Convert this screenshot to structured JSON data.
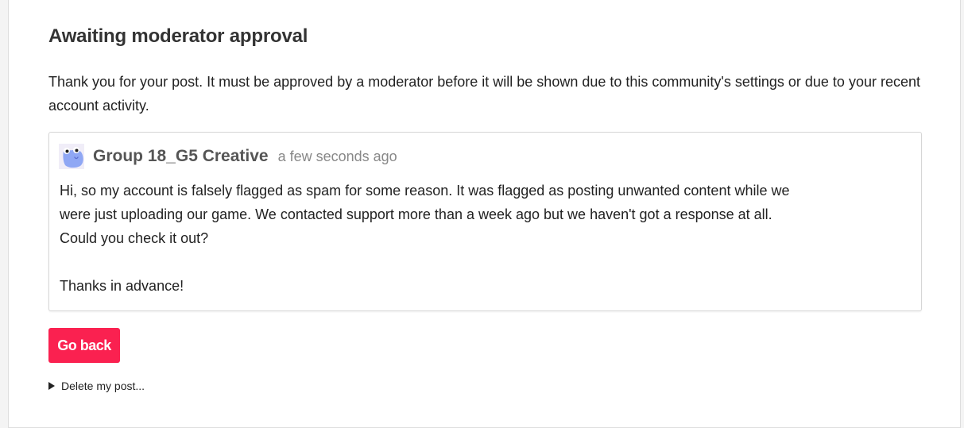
{
  "page": {
    "title": "Awaiting moderator approval",
    "intro": "Thank you for your post. It must be approved by a moderator before it will be shown due to this community's settings or due to your recent account activity."
  },
  "post": {
    "avatar_icon": "frog-avatar-icon",
    "author": "Group 18_G5 Creative",
    "timestamp": "a few seconds ago",
    "body_lines": [
      "Hi, so my account is falsely flagged as spam for some reason. It was flagged as posting unwanted content while we",
      "were just uploading our game. We contacted support more than a week ago but we haven't got a response at all.",
      "Could you check it out?",
      "Thanks in advance!"
    ]
  },
  "actions": {
    "go_back_label": "Go back",
    "delete_label": "Delete my post..."
  },
  "colors": {
    "accent": "#fa2150",
    "avatar_blue": "#8fa7f4"
  }
}
